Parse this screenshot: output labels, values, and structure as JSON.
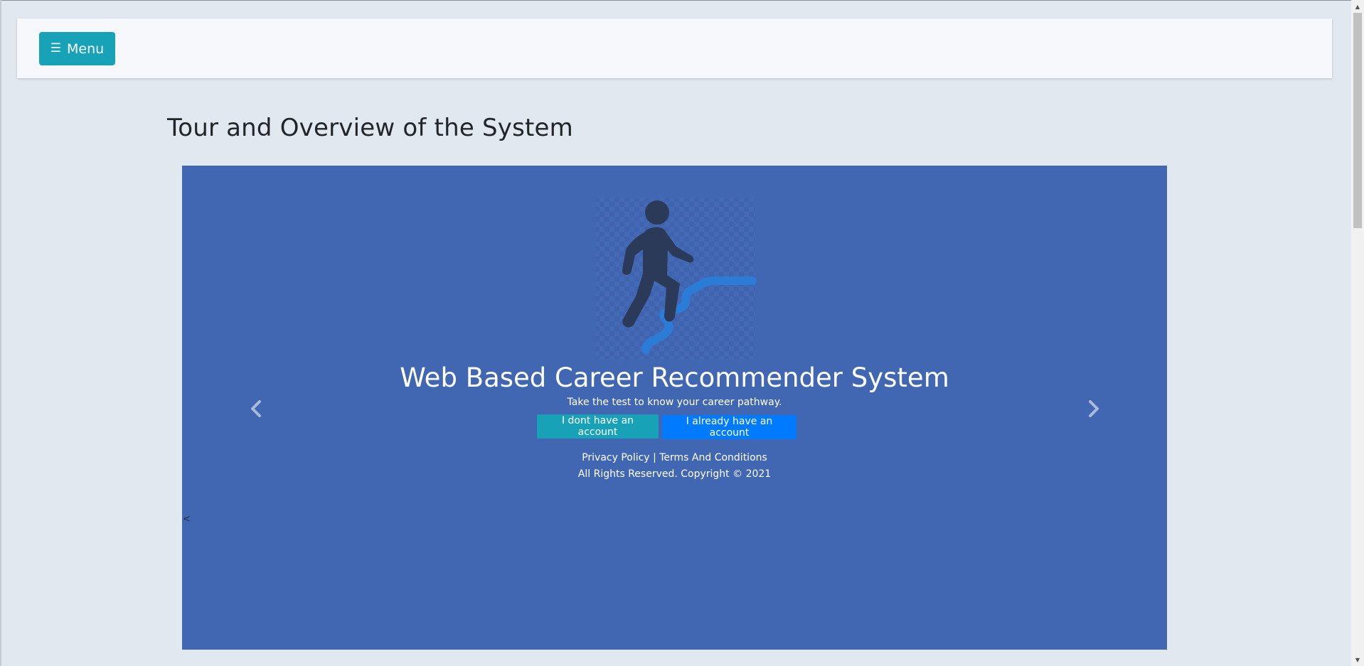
{
  "navbar": {
    "menu_icon": "hamburger-icon",
    "menu_label": "Menu"
  },
  "page": {
    "title": "Tour and Overview of the System"
  },
  "hero": {
    "logo_icon": "career-stairs-climber-icon",
    "title": "Web Based Career Recommender System",
    "subtitle": "Take the test to know your career pathway.",
    "register_label": "I dont have an account",
    "login_label": "I already have an account",
    "privacy_label": "Privacy Policy",
    "separator": "|",
    "terms_label": "Terms And Conditions",
    "copyright": "All Rights Reserved. Copyright © 2021"
  },
  "carousel": {
    "prev_icon": "chevron-left-icon",
    "next_icon": "chevron-right-icon",
    "stray_text": "<"
  },
  "colors": {
    "accent_teal": "#17a2b8",
    "primary_blue": "#007bff",
    "hero_background": "#4166b2",
    "page_background": "#e2e8f0"
  }
}
